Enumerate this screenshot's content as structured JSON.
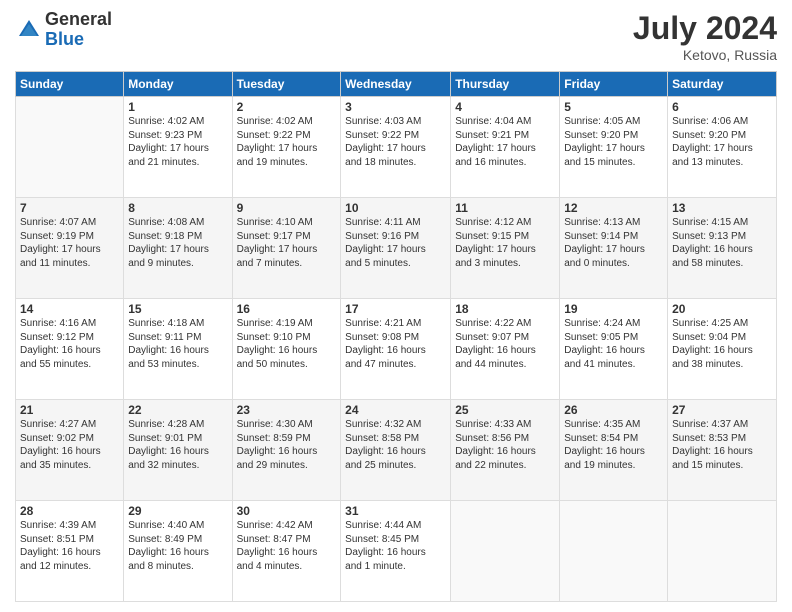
{
  "header": {
    "logo_general": "General",
    "logo_blue": "Blue",
    "month_title": "July 2024",
    "location": "Ketovo, Russia"
  },
  "days_of_week": [
    "Sunday",
    "Monday",
    "Tuesday",
    "Wednesday",
    "Thursday",
    "Friday",
    "Saturday"
  ],
  "weeks": [
    [
      {
        "day": "",
        "info": ""
      },
      {
        "day": "1",
        "info": "Sunrise: 4:02 AM\nSunset: 9:23 PM\nDaylight: 17 hours\nand 21 minutes."
      },
      {
        "day": "2",
        "info": "Sunrise: 4:02 AM\nSunset: 9:22 PM\nDaylight: 17 hours\nand 19 minutes."
      },
      {
        "day": "3",
        "info": "Sunrise: 4:03 AM\nSunset: 9:22 PM\nDaylight: 17 hours\nand 18 minutes."
      },
      {
        "day": "4",
        "info": "Sunrise: 4:04 AM\nSunset: 9:21 PM\nDaylight: 17 hours\nand 16 minutes."
      },
      {
        "day": "5",
        "info": "Sunrise: 4:05 AM\nSunset: 9:20 PM\nDaylight: 17 hours\nand 15 minutes."
      },
      {
        "day": "6",
        "info": "Sunrise: 4:06 AM\nSunset: 9:20 PM\nDaylight: 17 hours\nand 13 minutes."
      }
    ],
    [
      {
        "day": "7",
        "info": "Sunrise: 4:07 AM\nSunset: 9:19 PM\nDaylight: 17 hours\nand 11 minutes."
      },
      {
        "day": "8",
        "info": "Sunrise: 4:08 AM\nSunset: 9:18 PM\nDaylight: 17 hours\nand 9 minutes."
      },
      {
        "day": "9",
        "info": "Sunrise: 4:10 AM\nSunset: 9:17 PM\nDaylight: 17 hours\nand 7 minutes."
      },
      {
        "day": "10",
        "info": "Sunrise: 4:11 AM\nSunset: 9:16 PM\nDaylight: 17 hours\nand 5 minutes."
      },
      {
        "day": "11",
        "info": "Sunrise: 4:12 AM\nSunset: 9:15 PM\nDaylight: 17 hours\nand 3 minutes."
      },
      {
        "day": "12",
        "info": "Sunrise: 4:13 AM\nSunset: 9:14 PM\nDaylight: 17 hours\nand 0 minutes."
      },
      {
        "day": "13",
        "info": "Sunrise: 4:15 AM\nSunset: 9:13 PM\nDaylight: 16 hours\nand 58 minutes."
      }
    ],
    [
      {
        "day": "14",
        "info": "Sunrise: 4:16 AM\nSunset: 9:12 PM\nDaylight: 16 hours\nand 55 minutes."
      },
      {
        "day": "15",
        "info": "Sunrise: 4:18 AM\nSunset: 9:11 PM\nDaylight: 16 hours\nand 53 minutes."
      },
      {
        "day": "16",
        "info": "Sunrise: 4:19 AM\nSunset: 9:10 PM\nDaylight: 16 hours\nand 50 minutes."
      },
      {
        "day": "17",
        "info": "Sunrise: 4:21 AM\nSunset: 9:08 PM\nDaylight: 16 hours\nand 47 minutes."
      },
      {
        "day": "18",
        "info": "Sunrise: 4:22 AM\nSunset: 9:07 PM\nDaylight: 16 hours\nand 44 minutes."
      },
      {
        "day": "19",
        "info": "Sunrise: 4:24 AM\nSunset: 9:05 PM\nDaylight: 16 hours\nand 41 minutes."
      },
      {
        "day": "20",
        "info": "Sunrise: 4:25 AM\nSunset: 9:04 PM\nDaylight: 16 hours\nand 38 minutes."
      }
    ],
    [
      {
        "day": "21",
        "info": "Sunrise: 4:27 AM\nSunset: 9:02 PM\nDaylight: 16 hours\nand 35 minutes."
      },
      {
        "day": "22",
        "info": "Sunrise: 4:28 AM\nSunset: 9:01 PM\nDaylight: 16 hours\nand 32 minutes."
      },
      {
        "day": "23",
        "info": "Sunrise: 4:30 AM\nSunset: 8:59 PM\nDaylight: 16 hours\nand 29 minutes."
      },
      {
        "day": "24",
        "info": "Sunrise: 4:32 AM\nSunset: 8:58 PM\nDaylight: 16 hours\nand 25 minutes."
      },
      {
        "day": "25",
        "info": "Sunrise: 4:33 AM\nSunset: 8:56 PM\nDaylight: 16 hours\nand 22 minutes."
      },
      {
        "day": "26",
        "info": "Sunrise: 4:35 AM\nSunset: 8:54 PM\nDaylight: 16 hours\nand 19 minutes."
      },
      {
        "day": "27",
        "info": "Sunrise: 4:37 AM\nSunset: 8:53 PM\nDaylight: 16 hours\nand 15 minutes."
      }
    ],
    [
      {
        "day": "28",
        "info": "Sunrise: 4:39 AM\nSunset: 8:51 PM\nDaylight: 16 hours\nand 12 minutes."
      },
      {
        "day": "29",
        "info": "Sunrise: 4:40 AM\nSunset: 8:49 PM\nDaylight: 16 hours\nand 8 minutes."
      },
      {
        "day": "30",
        "info": "Sunrise: 4:42 AM\nSunset: 8:47 PM\nDaylight: 16 hours\nand 4 minutes."
      },
      {
        "day": "31",
        "info": "Sunrise: 4:44 AM\nSunset: 8:45 PM\nDaylight: 16 hours\nand 1 minute."
      },
      {
        "day": "",
        "info": ""
      },
      {
        "day": "",
        "info": ""
      },
      {
        "day": "",
        "info": ""
      }
    ]
  ]
}
